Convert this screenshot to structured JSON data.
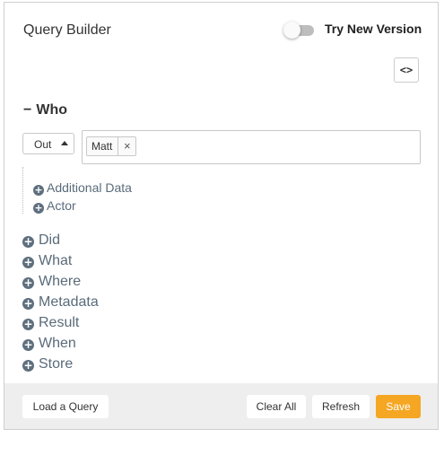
{
  "header": {
    "title": "Query Builder",
    "toggle_label": "Try New Version",
    "toggle_on": false,
    "code_button_label": "<>"
  },
  "who": {
    "collapse_symbol": "−",
    "label": "Who",
    "direction_select": "Out",
    "tags": [
      "Matt"
    ],
    "tag_remove_symbol": "×",
    "sub_items": [
      "Additional Data",
      "Actor"
    ]
  },
  "sections": [
    "Did",
    "What",
    "Where",
    "Metadata",
    "Result",
    "When",
    "Store"
  ],
  "icons": {
    "add": "+"
  },
  "footer": {
    "load_label": "Load a Query",
    "clear_label": "Clear All",
    "refresh_label": "Refresh",
    "save_label": "Save"
  },
  "colors": {
    "save_button": "#f5a623",
    "footer_bg": "#eeeeee",
    "section_text": "#5a6b7a",
    "plus_icon": "#5e6f7e"
  }
}
